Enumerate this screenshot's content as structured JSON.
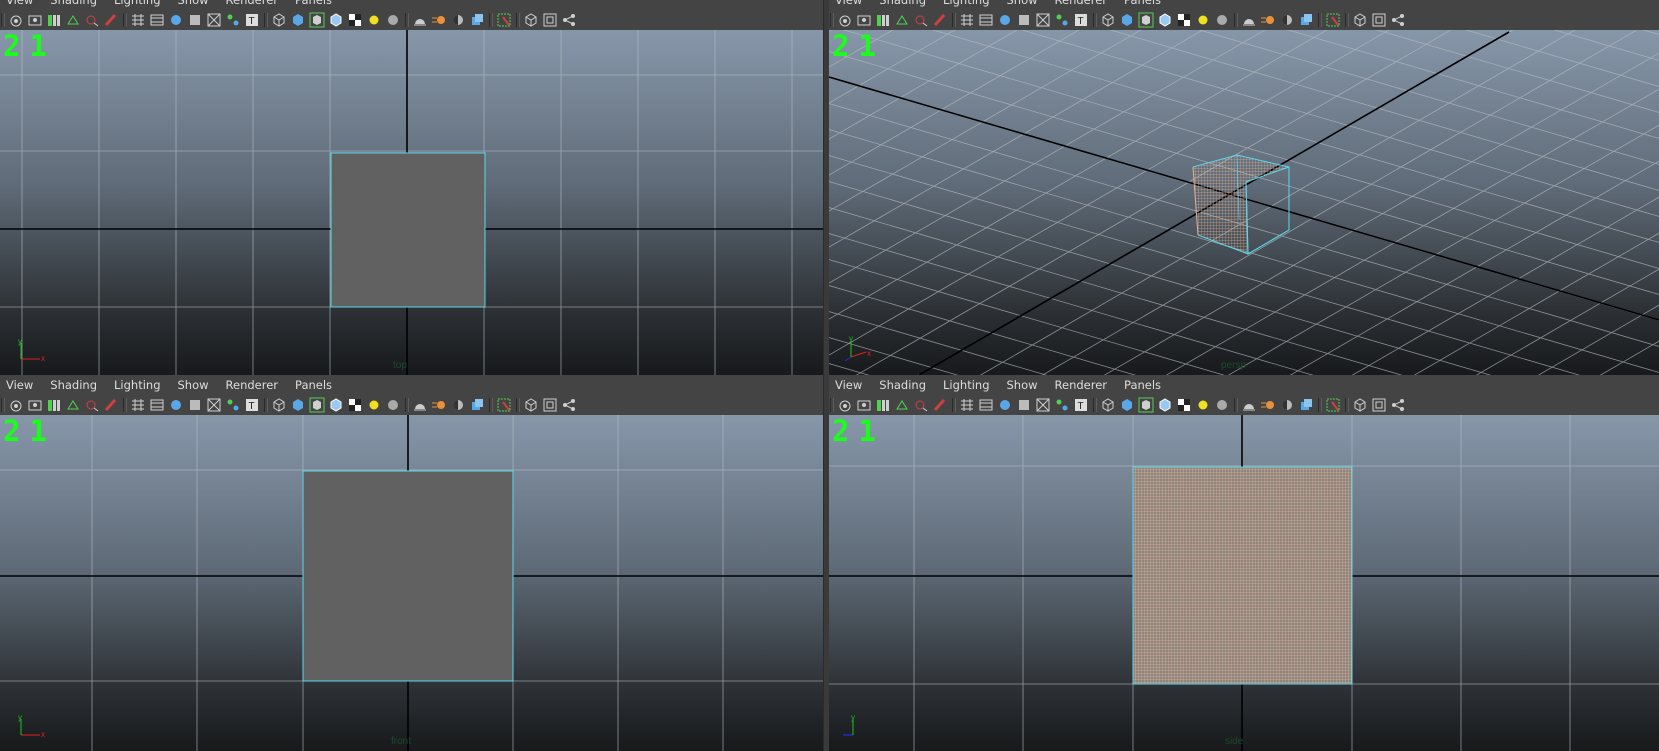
{
  "menu": [
    "View",
    "Shading",
    "Lighting",
    "Show",
    "Renderer",
    "Panels"
  ],
  "hud_text": "21",
  "axis_labels": {
    "x": "x",
    "y": "y"
  },
  "toolbar_icons": [
    "camera-select-icon",
    "camera-attributes-icon",
    "bookmark-icon",
    "image-plane-icon",
    "2d-pan-zoom-icon",
    "grease-pencil-icon",
    "|",
    "grid-icon",
    "film-gate-icon",
    "resolution-gate-icon",
    "gate-mask-icon",
    "field-chart-icon",
    "safe-action-icon",
    "safe-title-icon",
    "|",
    "wireframe-icon",
    "smooth-shade-icon",
    "wireframe-on-shaded-icon",
    "default-material-icon",
    "textured-icon",
    "use-all-lights-icon",
    "shadows-icon",
    "|",
    "screen-space-ao-icon",
    "motion-blur-icon",
    "multisample-aa-icon",
    "depth-of-field-icon",
    "|",
    "isolate-select-icon",
    "|",
    "xray-icon",
    "xray-active-icon",
    "xray-joints-icon"
  ],
  "panels": [
    {
      "id": "top",
      "camera": "top"
    },
    {
      "id": "persp",
      "camera": "persp"
    },
    {
      "id": "front",
      "camera": "front"
    },
    {
      "id": "side",
      "camera": "side"
    }
  ],
  "colors": {
    "hud_green": "#19ff19",
    "selection_cyan": "#5ad8f0",
    "wire_orange": "#e6b08c",
    "plane_gray": "#616161",
    "grid_line": "#b8bcc2",
    "axis_line": "#000000"
  }
}
